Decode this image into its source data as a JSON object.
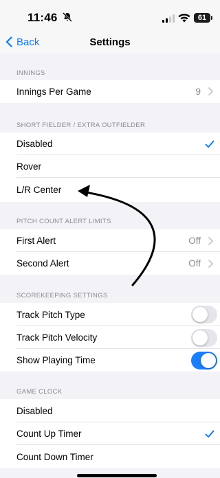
{
  "status": {
    "time": "11:46",
    "battery": "61"
  },
  "nav": {
    "back": "Back",
    "title": "Settings"
  },
  "sections": {
    "innings": {
      "header": "INNINGS",
      "per_game_label": "Innings Per Game",
      "per_game_value": "9"
    },
    "short_fielder": {
      "header": "SHORT FIELDER / EXTRA OUTFIELDER",
      "items": [
        "Disabled",
        "Rover",
        "L/R Center"
      ],
      "selected": "Disabled"
    },
    "pitch_count": {
      "header": "PITCH COUNT ALERT LIMITS",
      "first_label": "First Alert",
      "first_value": "Off",
      "second_label": "Second Alert",
      "second_value": "Off"
    },
    "scorekeeping": {
      "header": "SCOREKEEPING SETTINGS",
      "items": [
        {
          "label": "Track Pitch Type",
          "on": false
        },
        {
          "label": "Track Pitch Velocity",
          "on": false
        },
        {
          "label": "Show Playing Time",
          "on": true
        }
      ]
    },
    "game_clock": {
      "header": "GAME CLOCK",
      "items": [
        "Disabled",
        "Count Up Timer",
        "Count Down Timer"
      ],
      "selected": "Count Up Timer"
    }
  },
  "colors": {
    "accent": "#0a7aff",
    "toggle_on": "#1a7dfb",
    "background": "#f2f2f7"
  },
  "icons": [
    "bell-slash-icon",
    "signal-icon",
    "wifi-icon",
    "battery-icon",
    "chevron-left-icon",
    "chevron-right-icon",
    "checkmark-icon"
  ]
}
